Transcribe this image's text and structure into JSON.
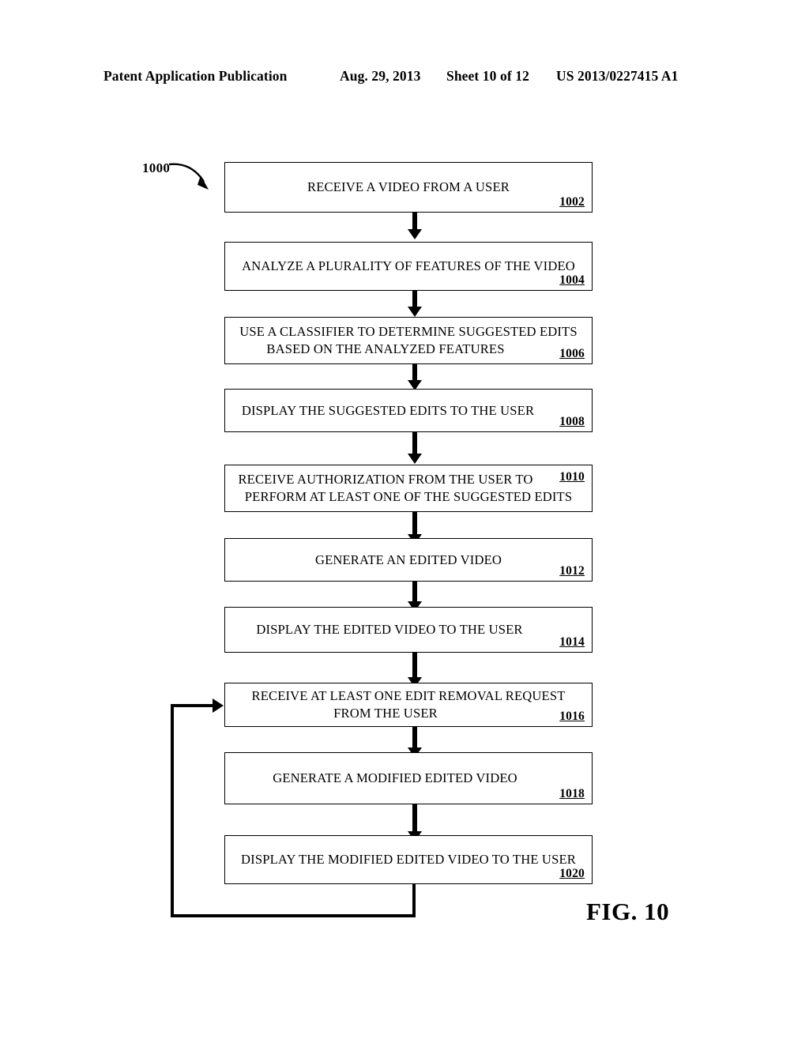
{
  "header": {
    "publication": "Patent Application Publication",
    "date": "Aug. 29, 2013",
    "sheet": "Sheet 10 of 12",
    "patent_number": "US 2013/0227415 A1"
  },
  "figure": {
    "caption": "FIG. 10",
    "diagram_label": "1000"
  },
  "flow": {
    "steps": [
      {
        "ref": "1002",
        "lines": [
          "RECEIVE A VIDEO FROM A USER"
        ],
        "ref_position": "bottom-right"
      },
      {
        "ref": "1004",
        "lines": [
          "ANALYZE A PLURALITY OF FEATURES OF THE VIDEO"
        ],
        "ref_position": "bottom-right"
      },
      {
        "ref": "1006",
        "lines": [
          "USE A CLASSIFIER TO DETERMINE SUGGESTED EDITS",
          "BASED ON THE ANALYZED FEATURES"
        ],
        "ref_position": "bottom-right"
      },
      {
        "ref": "1008",
        "lines": [
          "DISPLAY THE SUGGESTED EDITS TO THE USER"
        ],
        "ref_position": "bottom-right"
      },
      {
        "ref": "1010",
        "lines": [
          "RECEIVE AUTHORIZATION FROM THE USER TO",
          "PERFORM AT LEAST ONE OF THE SUGGESTED EDITS"
        ],
        "ref_position": "top-right"
      },
      {
        "ref": "1012",
        "lines": [
          "GENERATE AN EDITED VIDEO"
        ],
        "ref_position": "bottom-right"
      },
      {
        "ref": "1014",
        "lines": [
          "DISPLAY THE EDITED VIDEO TO THE USER"
        ],
        "ref_position": "bottom-right"
      },
      {
        "ref": "1016",
        "lines": [
          "RECEIVE AT LEAST ONE EDIT REMOVAL REQUEST",
          "FROM THE USER"
        ],
        "ref_position": "bottom-right"
      },
      {
        "ref": "1018",
        "lines": [
          "GENERATE A MODIFIED EDITED VIDEO"
        ],
        "ref_position": "bottom-right"
      },
      {
        "ref": "1020",
        "lines": [
          "DISPLAY THE MODIFIED EDITED VIDEO TO THE USER"
        ],
        "ref_position": "bottom-right"
      }
    ]
  }
}
